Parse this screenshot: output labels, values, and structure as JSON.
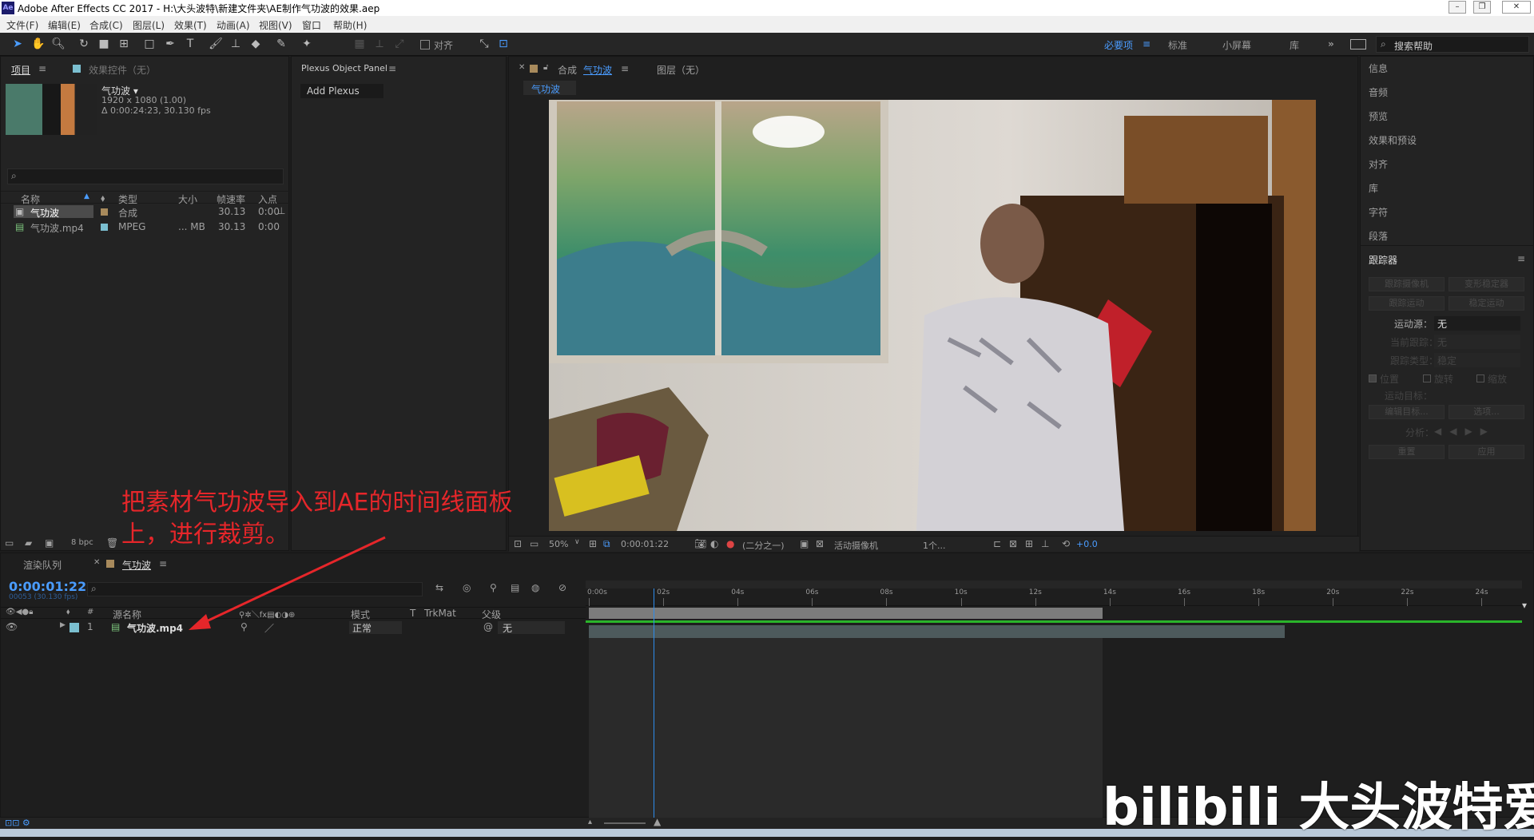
{
  "window": {
    "app_icon": "Ae",
    "title": "Adobe After Effects CC 2017 - H:\\大头波特\\新建文件夹\\AE制作气功波的效果.aep"
  },
  "menu": [
    "文件(F)",
    "编辑(E)",
    "合成(C)",
    "图层(L)",
    "效果(T)",
    "动画(A)",
    "视图(V)",
    "窗口",
    "帮助(H)"
  ],
  "toolbar": {
    "align_label": "对齐",
    "workspaces": [
      "必要项",
      "标准",
      "小屏幕",
      "库"
    ],
    "search_placeholder": "搜索帮助"
  },
  "project": {
    "tab_label": "项目",
    "effects_tab": "效果控件（无）",
    "comp_name": "气功波 ▾",
    "comp_res": "1920 x 1080 (1.00)",
    "comp_dur": "Δ 0:00:24:23, 30.130 fps",
    "columns": [
      "名称",
      "类型",
      "大小",
      "帧速率",
      "入点"
    ],
    "items": [
      {
        "name": "气功波",
        "type": "合成",
        "size": "",
        "fps": "30.13",
        "in": "0:00",
        "color": "#a88a5c"
      },
      {
        "name": "气功波.mp4",
        "type": "MPEG",
        "size": "... MB",
        "fps": "30.13",
        "in": "0:00",
        "color": "#7bbfd0"
      }
    ],
    "bpc": "8 bpc"
  },
  "plexus": {
    "title": "Plexus Object Panel",
    "button": "Add Plexus"
  },
  "composition": {
    "tab_prefix": "合成",
    "tab_name": "气功波",
    "layer_tab": "图层（无）",
    "breadcrumb": "气功波",
    "zoom": "50%",
    "timecode": "0:00:01:22",
    "resolution": "(二分之一)",
    "camera": "活动摄像机",
    "views": "1个...",
    "exposure": "+0.0"
  },
  "right_panels": [
    "信息",
    "音频",
    "预览",
    "效果和预设",
    "对齐",
    "库",
    "字符",
    "段落"
  ],
  "tracker": {
    "title": "跟踪器",
    "btns": [
      "跟踪摄像机",
      "变形稳定器",
      "跟踪运动",
      "稳定运动"
    ],
    "motion_source_label": "运动源：",
    "motion_source_value": "无",
    "current_track": "当前跟踪：",
    "current_track_value": "无",
    "track_type": "跟踪类型：",
    "track_type_value": "稳定",
    "checks": [
      "位置",
      "旋转",
      "缩放"
    ],
    "target": "运动目标：",
    "edit_target": "编辑目标...",
    "options": "选项...",
    "analyze": "分析：",
    "reset": "重置",
    "apply": "应用"
  },
  "timeline": {
    "render_tab": "渲染队列",
    "comp_tab": "气功波",
    "timecode": "0:00:01:22",
    "frame_info": "00053 (30.130 fps)",
    "col_source": "源名称",
    "col_mode": "模式",
    "col_t": "T",
    "col_trkmat": "TrkMat",
    "col_parent": "父级",
    "layer_num": "1",
    "layer_name": "气功波.mp4",
    "layer_mode": "正常",
    "layer_parent": "无",
    "ruler": [
      "0:00s",
      "02s",
      "04s",
      "06s",
      "08s",
      "10s",
      "12s",
      "14s",
      "16s",
      "18s",
      "20s",
      "22s",
      "24s"
    ],
    "playhead_sec": 1.75,
    "duration_sec": 25,
    "work_end_sec": 13.8,
    "layer_end_sec": 18.7
  },
  "annotation": "把素材气功波导入到AE的时间线面板上，进行裁剪。",
  "watermark": "bilibili 大头波特爱你",
  "colors": {
    "accent": "#2d8ceb",
    "annotation": "#e6262a",
    "work_bar": "#7c7c7c",
    "green_line": "#2ab52a"
  }
}
